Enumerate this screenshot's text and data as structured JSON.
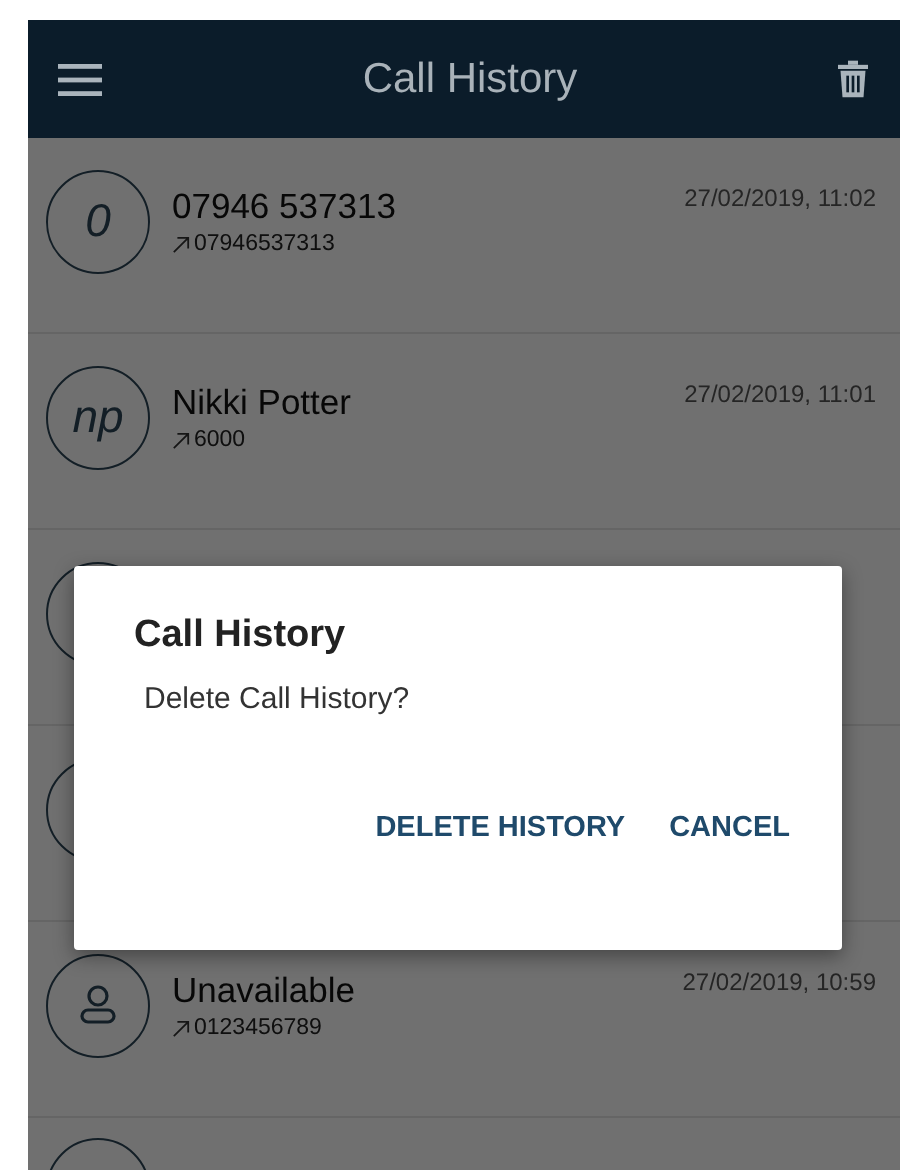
{
  "header": {
    "title": "Call History"
  },
  "calls": [
    {
      "kind": "initials",
      "initials": "0",
      "name": "07946 537313",
      "outgoing": true,
      "number": "07946537313",
      "time": "27/02/2019, 11:02"
    },
    {
      "kind": "initials",
      "initials": "np",
      "name": "Nikki Potter",
      "outgoing": true,
      "number": "6000",
      "time": "27/02/2019, 11:01"
    },
    {
      "kind": "covered"
    },
    {
      "kind": "covered"
    },
    {
      "kind": "person",
      "name": "Unavailable",
      "outgoing": true,
      "number": "0123456789",
      "time": "27/02/2019, 10:59"
    },
    {
      "kind": "cut"
    }
  ],
  "dialog": {
    "title": "Call History",
    "message": "Delete Call History?",
    "buttons": [
      "DELETE HISTORY",
      "CANCEL"
    ]
  }
}
